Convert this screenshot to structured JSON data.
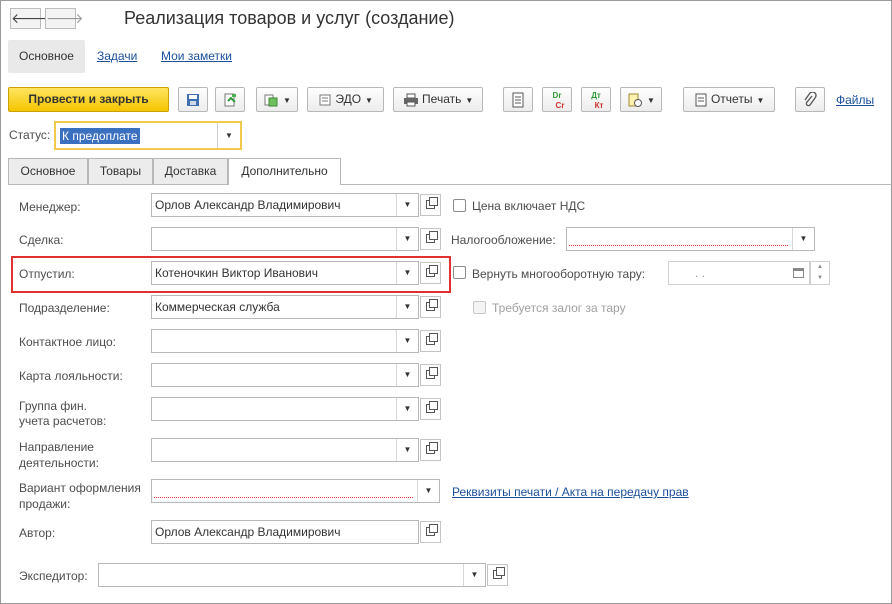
{
  "window": {
    "title": "Реализация товаров и услуг (создание)"
  },
  "nav": {
    "back_glyph": "🡐",
    "forward_glyph": "🡒"
  },
  "section_tabs": [
    {
      "label": "Основное"
    },
    {
      "label": "Задачи"
    },
    {
      "label": "Мои заметки"
    }
  ],
  "toolbar": {
    "post_close": "Провести и закрыть",
    "edo": "ЭДО",
    "print": "Печать",
    "reports": "Отчеты",
    "files": "Файлы",
    "dt_kt_dr": "Dr",
    "dt_kt_cr": "Cr",
    "dt_label": "Дт",
    "kt_label": "Кт"
  },
  "status": {
    "label": "Статус:",
    "value": "К предоплате"
  },
  "page_tabs": [
    {
      "label": "Основное"
    },
    {
      "label": "Товары"
    },
    {
      "label": "Доставка"
    },
    {
      "label": "Дополнительно"
    }
  ],
  "form": {
    "manager_label": "Менеджер:",
    "manager_value": "Орлов Александр Владимирович",
    "deal_label": "Сделка:",
    "deal_value": "",
    "released_label": "Отпустил:",
    "released_value": "Котеночкин Виктор Иванович",
    "division_label": "Подразделение:",
    "division_value": "Коммерческая служба",
    "contact_label": "Контактное лицо:",
    "contact_value": "",
    "loyalty_label": "Карта лояльности:",
    "loyalty_value": "",
    "fin_group_label_1": "Группа фин.",
    "fin_group_label_2": "учета расчетов:",
    "fin_group_value": "",
    "direction_label_1": "Направление",
    "direction_label_2": "деятельности:",
    "direction_value": "",
    "sale_variant_label_1": "Вариант оформления",
    "sale_variant_label_2": "продажи:",
    "sale_variant_value": "",
    "print_details_link": "Реквизиты печати / Акта на передачу прав",
    "author_label": "Автор:",
    "author_value": "Орлов Александр Владимирович",
    "forwarder_label": "Экспедитор:",
    "forwarder_value": "",
    "price_vat_label": "Цена включает НДС",
    "price_vat_checked": false,
    "taxation_label": "Налогообложение:",
    "taxation_value": "",
    "return_tare_label": "Вернуть многооборотную тару:",
    "return_tare_checked": false,
    "return_date_value": ". .",
    "deposit_label": "Требуется залог за тару",
    "deposit_checked": false
  },
  "colors": {
    "primary_button": "#f5c400",
    "link": "#1a4f9c",
    "highlight_border": "#e03030",
    "status_focus_border": "#f2c94c",
    "selection_bg": "#3b6fbf"
  }
}
